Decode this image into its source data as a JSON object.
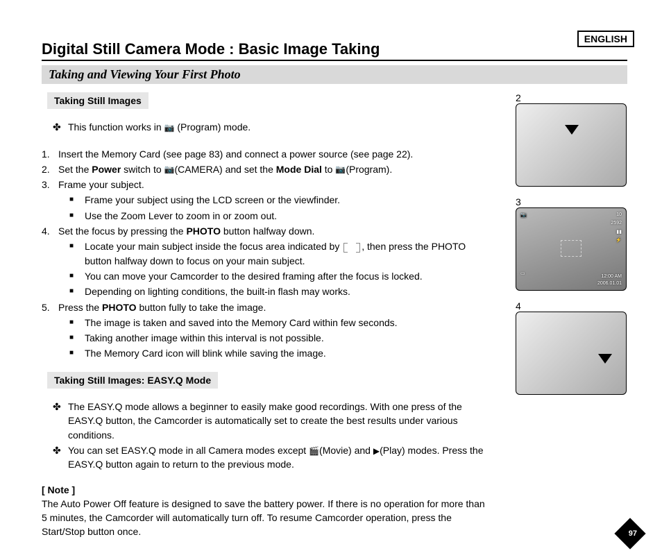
{
  "language_label": "ENGLISH",
  "title": "Digital Still Camera Mode : Basic Image Taking",
  "subtitle": "Taking and Viewing Your First Photo",
  "section1_label": "Taking Still Images",
  "s1_intro_pre": "This function works in ",
  "s1_intro_post": "(Program) mode.",
  "step1": "Insert the Memory Card (see page 83) and connect a power source (see page 22).",
  "step2_a": "Set the ",
  "step2_b": "Power",
  "step2_c": " switch to ",
  "step2_d": "(CAMERA) and set the ",
  "step2_e": "Mode Dial",
  "step2_f": " to ",
  "step2_g": "(Program).",
  "step3": "Frame your subject.",
  "step3_sub1": "Frame your subject using the LCD screen or the viewfinder.",
  "step3_sub2": "Use the Zoom Lever to zoom in or zoom out.",
  "step4_a": "Set the focus by pressing the ",
  "step4_b": "PHOTO",
  "step4_c": " button halfway down.",
  "step4_sub1_a": "Locate your main subject inside the focus area indicated by ",
  "step4_sub1_b": ", then press the PHOTO button halfway down to focus on your main subject.",
  "step4_sub2": "You can move your Camcorder to the desired framing after the focus is locked.",
  "step4_sub3": "Depending on lighting conditions, the built-in flash may works.",
  "step5_a": "Press the ",
  "step5_b": "PHOTO",
  "step5_c": " button fully to take the image.",
  "step5_sub1": "The image is taken and saved into the Memory Card within few seconds.",
  "step5_sub2": "Taking another image within this interval is not possible.",
  "step5_sub3": "The Memory Card icon will blink while saving the image.",
  "section2_label": "Taking Still Images: EASY.Q Mode",
  "s2_b1": "The EASY.Q mode allows a beginner to easily make good recordings. With one press of the EASY.Q button, the Camcorder is automatically set to create the best results under various conditions.",
  "s2_b2_a": "You can set EASY.Q mode in all Camera modes except ",
  "s2_b2_b": "(Movie) and ",
  "s2_b2_c": "(Play) modes. Press the EASY.Q button again to return to the previous mode.",
  "note_head": "[ Note ]",
  "note_body": "The Auto Power Off feature is designed to save the battery power. If there is no operation for more than 5 minutes, the Camcorder will automatically turn off. To resume Camcorder operation, press the Start/Stop button once.",
  "fig2_num": "2",
  "fig3_num": "3",
  "fig4_num": "4",
  "osd_count": "10",
  "osd_res": "2592",
  "osd_time": "12:00 AM",
  "osd_date": "2006.01.01",
  "page_number": "97"
}
